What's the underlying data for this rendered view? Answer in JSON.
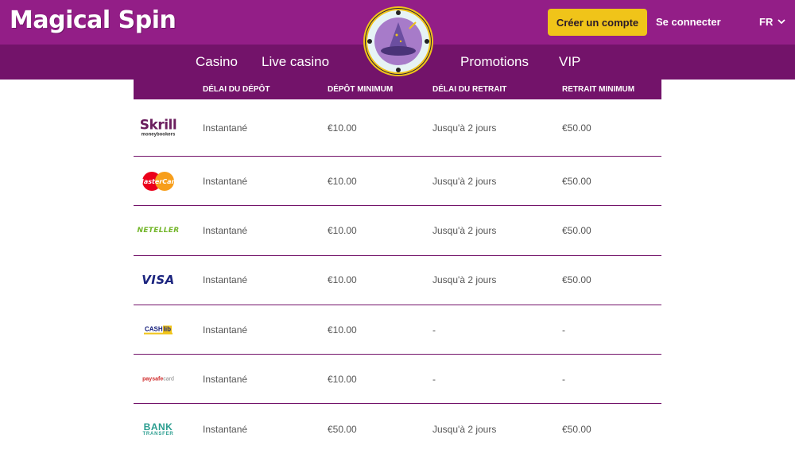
{
  "header": {
    "brand": "Magical Spin",
    "signup_label": "Créer un compte",
    "login_label": "Se connecter",
    "language": "FR"
  },
  "nav": {
    "items": [
      "Casino",
      "Live casino",
      "Promotions",
      "VIP"
    ]
  },
  "table": {
    "columns": [
      "Délai du dépôt",
      "Dépôt minimum",
      "Délai du retrait",
      "Retrait minimum"
    ],
    "rows": [
      {
        "logo": "skrill",
        "logo_text": "Skrill",
        "logo_sub": "moneybookers",
        "deposit_time": "Instantané",
        "deposit_min": "€10.00",
        "withdraw_time": "Jusqu'à 2 jours",
        "withdraw_min": "€50.00"
      },
      {
        "logo": "mastercard",
        "logo_text": "MasterCard",
        "deposit_time": "Instantané",
        "deposit_min": "€10.00",
        "withdraw_time": "Jusqu'à 2 jours",
        "withdraw_min": "€50.00"
      },
      {
        "logo": "neteller",
        "logo_text": "NETELLER",
        "deposit_time": "Instantané",
        "deposit_min": "€10.00",
        "withdraw_time": "Jusqu'à 2 jours",
        "withdraw_min": "€50.00"
      },
      {
        "logo": "visa",
        "logo_text": "VISA",
        "deposit_time": "Instantané",
        "deposit_min": "€10.00",
        "withdraw_time": "Jusqu'à 2 jours",
        "withdraw_min": "€50.00"
      },
      {
        "logo": "cashlib",
        "logo_text": "CASH",
        "logo_sub": "lib",
        "deposit_time": "Instantané",
        "deposit_min": "€10.00",
        "withdraw_time": "-",
        "withdraw_min": "-"
      },
      {
        "logo": "paysafecard",
        "logo_text": "paysafe",
        "logo_sub": "card",
        "deposit_time": "Instantané",
        "deposit_min": "€10.00",
        "withdraw_time": "-",
        "withdraw_min": "-"
      },
      {
        "logo": "bank-transfer",
        "logo_text": "BANK",
        "logo_sub": "TRANSFER",
        "deposit_time": "Instantané",
        "deposit_min": "€50.00",
        "withdraw_time": "Jusqu'à 2 jours",
        "withdraw_min": "€50.00"
      }
    ]
  },
  "icons": {
    "language_caret": "chevron-down-icon",
    "logo_badge": "wizard-hat-icon"
  },
  "colors": {
    "topbar": "#931e87",
    "navbar": "#73136a",
    "accent_button": "#f0c419",
    "row_border": "#73136a"
  }
}
